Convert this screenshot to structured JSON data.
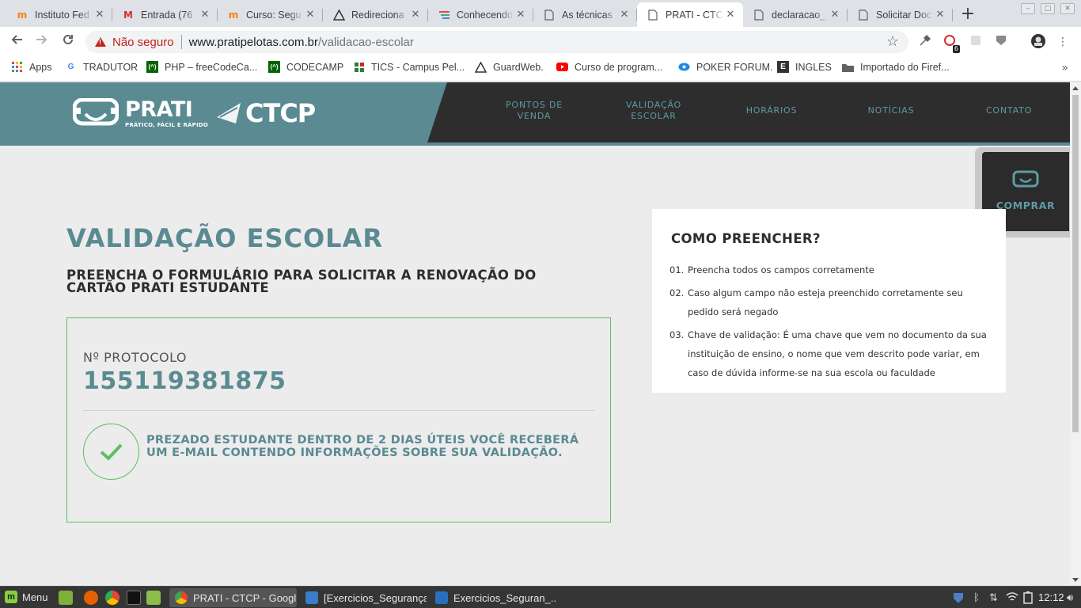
{
  "browser": {
    "tabs": [
      {
        "title": "Instituto Fed",
        "icon": "moodle-icon"
      },
      {
        "title": "Entrada (76",
        "icon": "gmail-icon"
      },
      {
        "title": "Curso: Segu",
        "icon": "moodle-icon"
      },
      {
        "title": "Redireciona",
        "icon": "triangle-logo-icon"
      },
      {
        "title": "Conhecendo",
        "icon": "stack-icon"
      },
      {
        "title": "As técnicas",
        "icon": "page-icon"
      },
      {
        "title": "PRATI - CTCP",
        "icon": "page-icon",
        "active": true
      },
      {
        "title": "declaracao_",
        "icon": "page-icon"
      },
      {
        "title": "Solicitar Doc",
        "icon": "page-icon"
      }
    ],
    "new_tab": "+",
    "omnibox": {
      "insecure_label": "Não seguro",
      "url_host": "www.pratipelotas.com.br",
      "url_path": "/validacao-escolar"
    },
    "extension_badge": "6",
    "bookmarks": [
      {
        "label": "Apps",
        "icon": "apps-grid-icon"
      },
      {
        "label": "TRADUTOR",
        "icon": "google-icon"
      },
      {
        "label": "PHP – freeCodeCa...",
        "icon": "freecodecamp-icon"
      },
      {
        "label": "CODECAMP",
        "icon": "freecodecamp-icon"
      },
      {
        "label": "TICS - Campus Pel...",
        "icon": "ifsul-icon"
      },
      {
        "label": "GuardWeb.",
        "icon": "triangle-logo-icon"
      },
      {
        "label": "Curso de program...",
        "icon": "youtube-icon"
      },
      {
        "label": "POKER FORUM.",
        "icon": "poker-icon"
      },
      {
        "label": "INGLES",
        "icon": "e-icon"
      },
      {
        "label": "Importado do Firef...",
        "icon": "folder-icon"
      }
    ],
    "bookmarks_more": "»"
  },
  "site": {
    "logo_prati": "PRATI",
    "logo_tagline": "PRÁTICO, FÁCIL E RÁPIDO",
    "logo_ctcp": "CTCP",
    "nav": [
      {
        "label": "PONTOS DE VENDA"
      },
      {
        "label": "VALIDAÇÃO ESCOLAR"
      },
      {
        "label": "HORÁRIOS"
      },
      {
        "label": "NOTÍCIAS"
      },
      {
        "label": "CONTATO"
      }
    ],
    "buy_label": "COMPRAR",
    "page_title": "VALIDAÇÃO ESCOLAR",
    "subtitle": "PREENCHA O FORMULÁRIO PARA SOLICITAR A RENOVAÇÃO DO CARTÃO PRATI ESTUDANTE",
    "protocol_label": "Nº PROTOCOLO",
    "protocol_number": "155119381875",
    "success_message": "PREZADO ESTUDANTE DENTRO DE 2 DIAS ÚTEIS VOCÊ RECEBERÁ UM E-MAIL CONTENDO INFORMAÇÕES SOBRE SUA VALIDAÇÃO.",
    "help": {
      "title": "COMO PREENCHER?",
      "items": [
        {
          "num": "01.",
          "text": "Preencha todos os campos corretamente"
        },
        {
          "num": "02.",
          "text": "Caso algum campo não esteja preenchido corretamente seu pedido será negado"
        },
        {
          "num": "03.",
          "text": "Chave de validação: É uma chave que vem no documento da sua instituição de ensino, o nome que vem descrito pode variar, em caso de dúvida informe-se na sua escola ou faculdade"
        }
      ]
    }
  },
  "taskbar": {
    "menu_label": "Menu",
    "tasks": [
      {
        "label": "PRATI - CTCP - Googl...",
        "active": true
      },
      {
        "label": "[Exercicios_Segurança..."
      },
      {
        "label": "Exercicios_Seguran_..."
      }
    ],
    "clock": "12:12"
  },
  "colors": {
    "brand_teal": "#5a8a92",
    "nav_dark": "#2d2d2d",
    "success_green": "#5cbf5c",
    "insecure_red": "#c5221f"
  }
}
